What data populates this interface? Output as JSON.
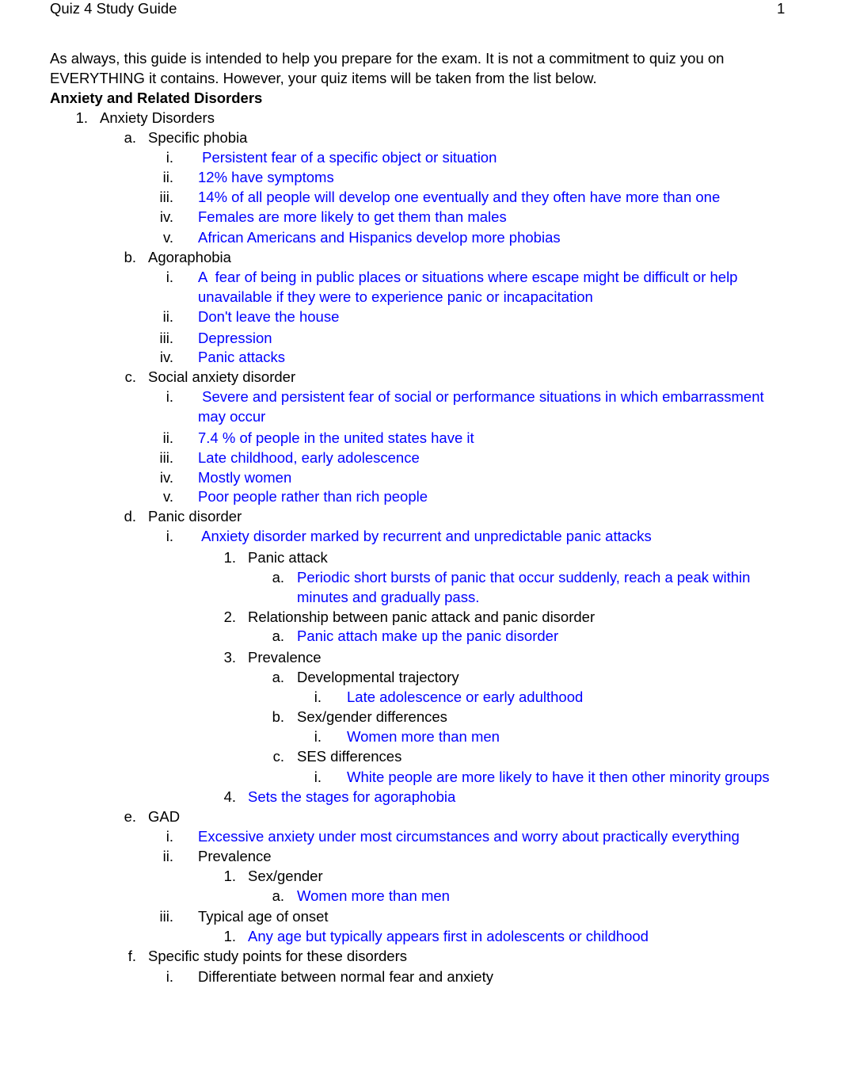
{
  "header": {
    "title": "Quiz 4 Study Guide",
    "page_number": "1"
  },
  "intro": "As always, this guide is intended to help you prepare for the exam. It is not a commitment to quiz you on EVERYTHING it contains. However, your quiz items will be taken from the list below.",
  "section_title": "Anxiety and Related Disorders",
  "colors": {
    "answer": "#0000ff",
    "text": "#000000"
  },
  "lines": [
    {
      "m": "1.",
      "t": "Anxiety Disorders",
      "lvl": 1,
      "blue": false
    },
    {
      "m": "a.",
      "t": "Specific phobia",
      "lvl": 2,
      "blue": false
    },
    {
      "m": "i.",
      "t": " Persistent fear of a specific object or situation",
      "lvl": 3,
      "blue": true
    },
    {
      "m": "ii.",
      "t": "12% have symptoms",
      "lvl": 3,
      "blue": true
    },
    {
      "m": "iii.",
      "t": "14% of all people will develop one eventually and they often have more than one",
      "lvl": 3,
      "blue": true
    },
    {
      "m": "iv.",
      "t": "Females are more likely to get them than males",
      "lvl": 3,
      "blue": true
    },
    {
      "m": "v.",
      "t": "African Americans and Hispanics develop more phobias",
      "lvl": 3,
      "blue": true
    },
    {
      "m": "b.",
      "t": "Agoraphobia",
      "lvl": 2,
      "blue": false
    },
    {
      "m": "i.",
      "t": "A  fear of being in public places or situations where escape might be difficult or help",
      "lvl": 3,
      "blue": true
    },
    {
      "m": "",
      "t": "unavailable if they were to experience panic or incapacitation",
      "lvl": 3,
      "blue": true
    },
    {
      "m": "ii.",
      "t": "Don't leave the house",
      "lvl": 3,
      "blue": true
    },
    {
      "m": "iii.",
      "t": "Depression",
      "lvl": 3,
      "blue": true
    },
    {
      "m": "iv.",
      "t": "Panic attacks",
      "lvl": 3,
      "blue": true
    },
    {
      "m": "c.",
      "t": "Social anxiety disorder",
      "lvl": 2,
      "blue": false
    },
    {
      "m": "i.",
      "t": " Severe and persistent fear of social or performance situations in which embarrassment",
      "lvl": 3,
      "blue": true
    },
    {
      "m": "",
      "t": "may occur",
      "lvl": 3,
      "blue": true
    },
    {
      "m": "ii.",
      "t": "7.4 % of people in the united states have it",
      "lvl": 3,
      "blue": true
    },
    {
      "m": "iii.",
      "t": "Late childhood, early adolescence",
      "lvl": 3,
      "blue": true
    },
    {
      "m": "iv.",
      "t": "Mostly women",
      "lvl": 3,
      "blue": true
    },
    {
      "m": "v.",
      "t": "Poor people rather than rich people",
      "lvl": 3,
      "blue": true
    },
    {
      "m": "d.",
      "t": "Panic disorder",
      "lvl": 2,
      "blue": false
    },
    {
      "m": "i.",
      "t": " Anxiety disorder marked by recurrent and unpredictable panic attacks",
      "lvl": 3,
      "blue": true
    },
    {
      "m": "1.",
      "t": "Panic attack",
      "lvl": 4,
      "blue": false
    },
    {
      "m": "a.",
      "t": "Periodic short bursts of panic that occur suddenly, reach a peak within",
      "lvl": 5,
      "blue": true
    },
    {
      "m": "",
      "t": "minutes and gradually pass.",
      "lvl": 5,
      "blue": true
    },
    {
      "m": "2.",
      "t": "Relationship between panic attack and panic disorder",
      "lvl": 4,
      "blue": false
    },
    {
      "m": "a.",
      "t": "Panic attach make up the panic disorder",
      "lvl": 5,
      "blue": true
    },
    {
      "m": "3.",
      "t": "Prevalence",
      "lvl": 4,
      "blue": false
    },
    {
      "m": "a.",
      "t": "Developmental trajectory",
      "lvl": 5,
      "blue": false
    },
    {
      "m": "i.",
      "t": "Late adolescence or early adulthood",
      "lvl": 6,
      "blue": true
    },
    {
      "m": "b.",
      "t": "Sex/gender differences",
      "lvl": 5,
      "blue": false
    },
    {
      "m": "i.",
      "t": "Women more than men",
      "lvl": 6,
      "blue": true
    },
    {
      "m": "c.",
      "t": "SES differences",
      "lvl": 5,
      "blue": false
    },
    {
      "m": "i.",
      "t": "White people are more likely to have it then other minority groups",
      "lvl": 6,
      "blue": true
    },
    {
      "m": "4.",
      "t": "Sets the stages for agoraphobia",
      "lvl": 4,
      "blue": true
    },
    {
      "m": "e.",
      "t": "GAD",
      "lvl": 2,
      "blue": false
    },
    {
      "m": "i.",
      "t": "Excessive anxiety under most circumstances and worry about practically everything",
      "lvl": 3,
      "blue": true
    },
    {
      "m": "ii.",
      "t": "Prevalence",
      "lvl": 3,
      "blue": false
    },
    {
      "m": "1.",
      "t": "Sex/gender",
      "lvl": 4,
      "blue": false
    },
    {
      "m": "a.",
      "t": "Women more than men",
      "lvl": 5,
      "blue": true
    },
    {
      "m": "iii.",
      "t": "Typical age of onset",
      "lvl": 3,
      "blue": false
    },
    {
      "m": "1.",
      "t": "Any age but typically appears first in adolescents or childhood",
      "lvl": 4,
      "blue": true
    },
    {
      "m": "f.",
      "t": "Specific study points for these disorders",
      "lvl": 2,
      "blue": false
    },
    {
      "m": "i.",
      "t": "Differentiate between normal fear and anxiety",
      "lvl": 3,
      "blue": false
    }
  ]
}
